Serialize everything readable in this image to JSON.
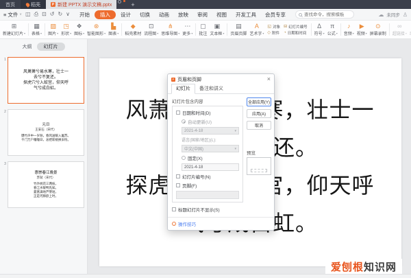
{
  "colors": {
    "accent": "#ed6b2d",
    "titlebar": "#3b3f4b",
    "link_blue": "#4a7df0",
    "watermark_orange": "#e8541c"
  },
  "titlebar": {
    "home_tab": "首页",
    "docer_tab": "稻壳",
    "doc_tab": "新建 PPTX 演示文稿.pptx",
    "doc_icon_letter": "P",
    "new_tab": "+"
  },
  "menubar": {
    "file_menu": "文件",
    "qat_icons": [
      {
        "id": "save",
        "glyph": "◫"
      },
      {
        "id": "print",
        "glyph": "⎙"
      },
      {
        "id": "print-preview",
        "glyph": "⊡"
      },
      {
        "id": "undo",
        "glyph": "↺"
      },
      {
        "id": "redo",
        "glyph": "↻"
      },
      {
        "id": "customize-qat",
        "glyph": "∨"
      }
    ],
    "tabs": [
      {
        "id": "home",
        "label": "开始",
        "active": false
      },
      {
        "id": "insert",
        "label": "插入",
        "active": true
      },
      {
        "id": "design",
        "label": "设计",
        "active": false
      },
      {
        "id": "transition",
        "label": "切换",
        "active": false
      },
      {
        "id": "animation",
        "label": "动画",
        "active": false
      },
      {
        "id": "slideshow",
        "label": "放映",
        "active": false
      },
      {
        "id": "review",
        "label": "审阅",
        "active": false
      },
      {
        "id": "view",
        "label": "视图",
        "active": false
      },
      {
        "id": "developer",
        "label": "开发工具",
        "active": false
      },
      {
        "id": "member",
        "label": "会员专享",
        "active": false
      }
    ],
    "search_placeholder": "查找命令，搜索模板",
    "sync_status": "未同步"
  },
  "ribbon": {
    "items": [
      {
        "type": "item",
        "id": "new-slide",
        "label": "新建幻灯片",
        "glyph": "⊞",
        "caret": true
      },
      {
        "type": "sep"
      },
      {
        "type": "item",
        "id": "table",
        "label": "表格",
        "glyph": "▦",
        "caret": true
      },
      {
        "type": "sep"
      },
      {
        "type": "item",
        "id": "picture",
        "label": "图片",
        "glyph": "▨",
        "caret": true,
        "accent": true
      },
      {
        "type": "item",
        "id": "shape",
        "label": "形状",
        "glyph": "◳",
        "caret": true,
        "accent": true
      },
      {
        "type": "item",
        "id": "icon-library",
        "label": "图标",
        "glyph": "❖",
        "caret": true
      },
      {
        "type": "item",
        "id": "smartart",
        "label": "智能图形",
        "glyph": "⊛",
        "caret": true,
        "accent": true
      },
      {
        "type": "item",
        "id": "chart",
        "label": "图表",
        "glyph": "▙",
        "caret": true,
        "accent": true
      },
      {
        "type": "sep"
      },
      {
        "type": "item",
        "id": "docer-material",
        "label": "稻壳素材",
        "glyph": "◆",
        "accent": true
      },
      {
        "type": "item",
        "id": "flowchart",
        "label": "流程图",
        "glyph": "⊡",
        "caret": true
      },
      {
        "type": "item",
        "id": "mindmap",
        "label": "思维导图",
        "glyph": "⋔",
        "caret": true,
        "accent": true
      },
      {
        "type": "item",
        "id": "more",
        "label": "更多",
        "glyph": "⋯",
        "caret": true
      },
      {
        "type": "sep"
      },
      {
        "type": "item",
        "id": "comment",
        "label": "批注",
        "glyph": "▢"
      },
      {
        "type": "item",
        "id": "textbox",
        "label": "文本框",
        "glyph": "▣",
        "caret": true
      },
      {
        "type": "sep"
      },
      {
        "type": "item",
        "id": "header-footer",
        "label": "页眉页脚",
        "glyph": "▤"
      },
      {
        "type": "item",
        "id": "wordart",
        "label": "艺术字",
        "glyph": "A",
        "caret": true,
        "accent": true
      },
      {
        "type": "stack",
        "cells": [
          {
            "id": "object",
            "label": "对象",
            "glyph": "◱"
          },
          {
            "id": "slide-number",
            "label": "幻灯片编号",
            "glyph": "⊟"
          },
          {
            "id": "attachment",
            "label": "附件",
            "glyph": "◇"
          },
          {
            "id": "date-time",
            "label": "日期和时间",
            "glyph": "◔"
          }
        ]
      },
      {
        "type": "sep"
      },
      {
        "type": "item",
        "id": "symbol",
        "label": "符号",
        "glyph": "Δ",
        "caret": true
      },
      {
        "type": "item",
        "id": "formula",
        "label": "公式",
        "glyph": "π",
        "caret": true
      },
      {
        "type": "sep"
      },
      {
        "type": "item",
        "id": "audio",
        "label": "音频",
        "glyph": "♪",
        "caret": true,
        "accent": true
      },
      {
        "type": "item",
        "id": "video",
        "label": "视频",
        "glyph": "▶",
        "caret": true,
        "accent": true
      },
      {
        "type": "item",
        "id": "screen-record",
        "label": "屏幕录制",
        "glyph": "⊙",
        "accent": true
      },
      {
        "type": "sep"
      },
      {
        "type": "item",
        "id": "hyperlink",
        "label": "超链接",
        "glyph": "∞",
        "caret": true,
        "disabled": true
      },
      {
        "type": "item",
        "id": "action",
        "label": "动作",
        "glyph": "☞",
        "disabled": true
      }
    ]
  },
  "slides_panel": {
    "outline_tab": "大纲",
    "slides_tab": "幻灯片",
    "slides": [
      {
        "number": "1",
        "selected": true,
        "title": "",
        "author": "",
        "lines": [
          "风萧萧兮易水寒，壮士一",
          "去兮不复还。",
          "探虎穴兮入蛟宫，仰天呼",
          "气兮成白虹。"
        ]
      },
      {
        "number": "2",
        "selected": false,
        "title": "元日",
        "author": "王安石（宋代）",
        "lines": [
          "爆竹声中一岁除，春风送暖入屠苏。",
          "千门万户曈曈日，总把新桃换旧符。"
        ]
      },
      {
        "number": "3",
        "selected": false,
        "title": "惠崇春江晚景",
        "author": "苏轼（宋代）",
        "lines": [
          "竹外桃花三两枝，",
          "春江水暖鸭先知。",
          "蒌蒿满地芦芽短，",
          "正是河豚欲上时。"
        ]
      }
    ]
  },
  "slide_canvas": {
    "lines": [
      "风萧萧兮易水寒，壮士一",
      "去兮不复还。",
      "探虎穴兮入蛟宫，仰天呼",
      "气兮成白虹。"
    ]
  },
  "dialog": {
    "title": "页眉和页脚",
    "icon_letter": "P",
    "close": "×",
    "tabs": {
      "slide": "幻灯片",
      "notes": "备注和讲义"
    },
    "group_label": "幻灯片包含内容",
    "date_checkbox": "日期和时间(D)",
    "auto_update_radio": "自动更新(U)",
    "auto_date_value": "2021-4-18",
    "language_label": "语言(国家/地区)(L):",
    "language_value": "中文(中国)",
    "fixed_radio": "固定(X)",
    "fixed_date_value": "2021-4-18",
    "slide_number_checkbox": "幻灯片编号(N)",
    "footer_checkbox": "页脚(F)",
    "title_slide_checkbox": "标题幻灯片不显示(S)",
    "apply_all_button": "全部应用(Y)",
    "apply_button": "应用(A)",
    "cancel_button": "取消",
    "preview_label": "预览",
    "tips_link": "操作技巧"
  },
  "watermark": {
    "orange": "爱刨根",
    "dark": "知识网"
  }
}
